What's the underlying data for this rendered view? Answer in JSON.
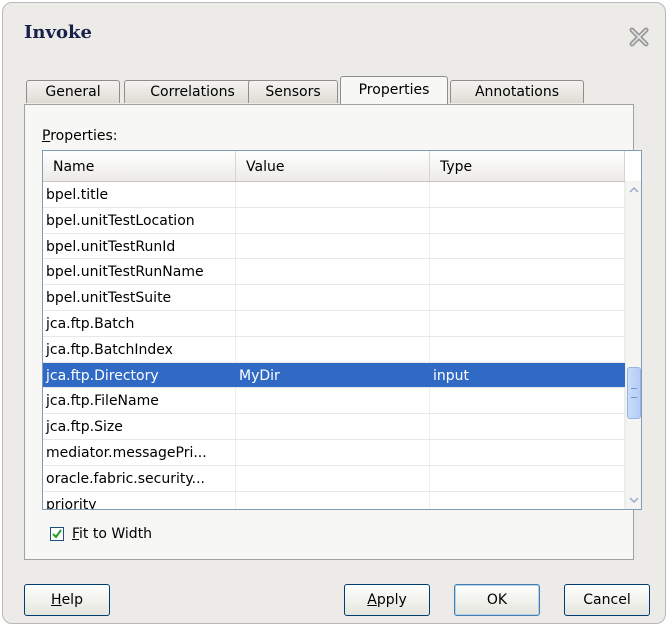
{
  "dialog": {
    "title": "Invoke",
    "close_icon": "close-icon"
  },
  "tabs": [
    {
      "label": "General",
      "active": false
    },
    {
      "label": "Correlations",
      "active": false
    },
    {
      "label": "Sensors",
      "active": false
    },
    {
      "label": "Properties",
      "active": true
    },
    {
      "label": "Annotations",
      "active": false
    }
  ],
  "properties": {
    "section_label_mnemonic": "P",
    "section_label_rest": "roperties:",
    "columns": [
      "Name",
      "Value",
      "Type"
    ],
    "rows": [
      {
        "name": "bpel.title",
        "value": "",
        "type": ""
      },
      {
        "name": "bpel.unitTestLocation",
        "value": "",
        "type": ""
      },
      {
        "name": "bpel.unitTestRunId",
        "value": "",
        "type": ""
      },
      {
        "name": "bpel.unitTestRunName",
        "value": "",
        "type": ""
      },
      {
        "name": "bpel.unitTestSuite",
        "value": "",
        "type": ""
      },
      {
        "name": "jca.ftp.Batch",
        "value": "",
        "type": ""
      },
      {
        "name": "jca.ftp.BatchIndex",
        "value": "",
        "type": ""
      },
      {
        "name": "jca.ftp.Directory",
        "value": "MyDir",
        "type": "input",
        "selected": true
      },
      {
        "name": "jca.ftp.FileName",
        "value": "",
        "type": ""
      },
      {
        "name": "jca.ftp.Size",
        "value": "",
        "type": ""
      },
      {
        "name": "mediator.messagePri...",
        "value": "",
        "type": ""
      },
      {
        "name": "oracle.fabric.security...",
        "value": "",
        "type": ""
      },
      {
        "name": "priority",
        "value": "",
        "type": ""
      }
    ]
  },
  "fit_to_width": {
    "checked": true,
    "mnemonic": "F",
    "label_rest": "it to Width"
  },
  "buttons": {
    "help_mnemonic": "H",
    "help_rest": "elp",
    "apply_mnemonic": "A",
    "apply_rest": "pply",
    "ok": "OK",
    "cancel": "Cancel"
  },
  "colors": {
    "selection": "#316ac5",
    "dialog_bg": "#ecebe8",
    "check_mark": "#21a121"
  }
}
